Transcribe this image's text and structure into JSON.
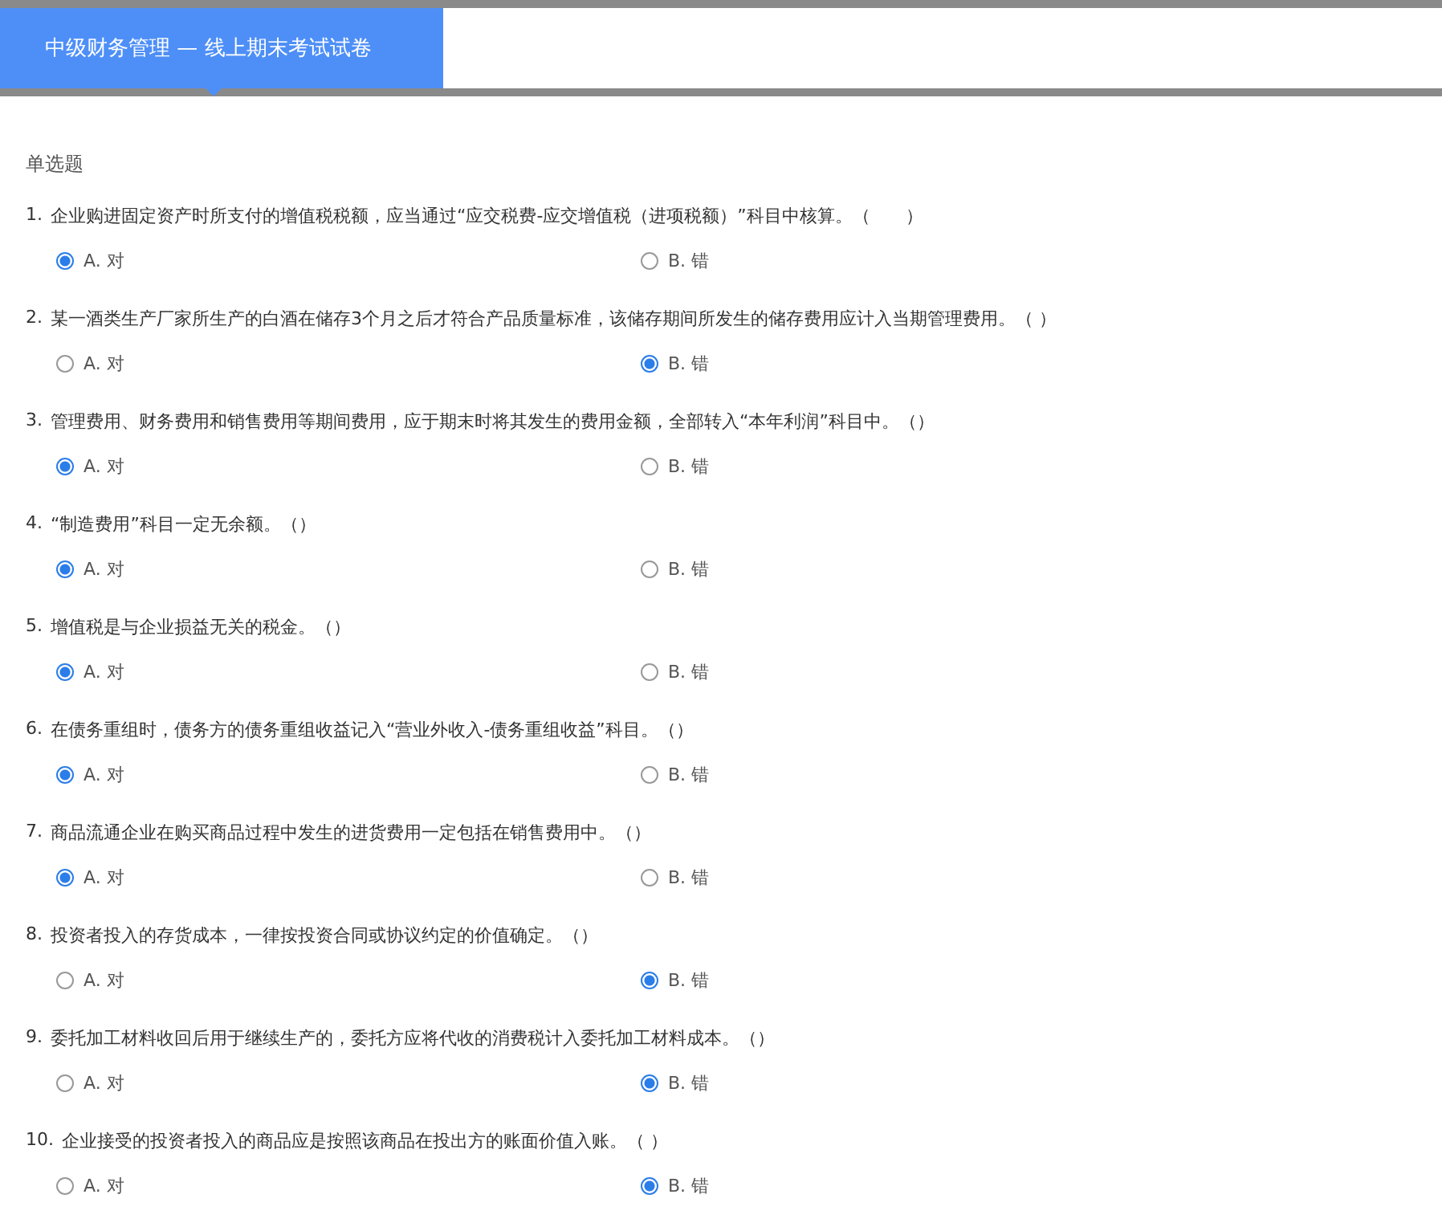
{
  "tabs": [
    {
      "label": "中级财务管理 — 线上期末考试试卷",
      "selected": true
    }
  ],
  "section_title": "单选题",
  "questions": [
    {
      "number": "1.",
      "text": "企业购进固定资产时所支付的增值税税额，应当通过“应交税费-应交增值税（进项税额）”科目中核算。（　　）",
      "options": [
        {
          "label": "A. 对",
          "selected": true
        },
        {
          "label": "B. 错",
          "selected": false
        }
      ]
    },
    {
      "number": "2.",
      "text": "某一酒类生产厂家所生产的白酒在储存3个月之后才符合产品质量标准，该储存期间所发生的储存费用应计入当期管理费用。（ ）",
      "options": [
        {
          "label": "A. 对",
          "selected": false
        },
        {
          "label": "B. 错",
          "selected": true
        }
      ]
    },
    {
      "number": "3.",
      "text": "管理费用、财务费用和销售费用等期间费用，应于期末时将其发生的费用金额，全部转入“本年利润”科目中。（）",
      "options": [
        {
          "label": "A. 对",
          "selected": true
        },
        {
          "label": "B. 错",
          "selected": false
        }
      ]
    },
    {
      "number": "4.",
      "text": "“制造费用”科目一定无余额。（）",
      "options": [
        {
          "label": "A. 对",
          "selected": true
        },
        {
          "label": "B. 错",
          "selected": false
        }
      ]
    },
    {
      "number": "5.",
      "text": "增值税是与企业损益无关的税金。（）",
      "options": [
        {
          "label": "A. 对",
          "selected": true
        },
        {
          "label": "B. 错",
          "selected": false
        }
      ]
    },
    {
      "number": "6.",
      "text": "在债务重组时，债务方的债务重组收益记入“营业外收入-债务重组收益”科目。（）",
      "options": [
        {
          "label": "A. 对",
          "selected": true
        },
        {
          "label": "B. 错",
          "selected": false
        }
      ]
    },
    {
      "number": "7.",
      "text": "商品流通企业在购买商品过程中发生的进货费用一定包括在销售费用中。（）",
      "options": [
        {
          "label": "A. 对",
          "selected": true
        },
        {
          "label": "B. 错",
          "selected": false
        }
      ]
    },
    {
      "number": "8.",
      "text": "投资者投入的存货成本，一律按投资合同或协议约定的价值确定。（）",
      "options": [
        {
          "label": "A. 对",
          "selected": false
        },
        {
          "label": "B. 错",
          "selected": true
        }
      ]
    },
    {
      "number": "9.",
      "text": "委托加工材料收回后用于继续生产的，委托方应将代收的消费税计入委托加工材料成本。（）",
      "options": [
        {
          "label": "A. 对",
          "selected": false
        },
        {
          "label": "B. 错",
          "selected": true
        }
      ]
    },
    {
      "number": "10.",
      "text": "企业接受的投资者投入的商品应是按照该商品在投出方的账面价值入账。（ ）",
      "options": [
        {
          "label": "A. 对",
          "selected": false
        },
        {
          "label": "B. 错",
          "selected": true
        }
      ]
    }
  ]
}
